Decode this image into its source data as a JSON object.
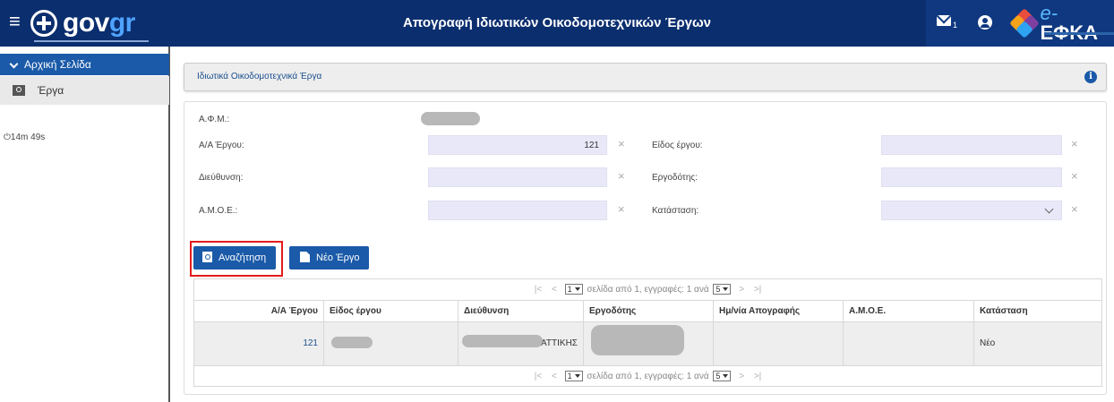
{
  "header": {
    "logo_text_a": "gov",
    "logo_text_b": "gr",
    "title": "Απογραφή Ιδιωτικών Οικοδομοτεχνικών Έργων",
    "mail_count": "1",
    "efka_prefix": "e-",
    "efka_name": "ΕΦΚΑ"
  },
  "sidebar": {
    "home_label": "Αρχική Σελίδα",
    "works_label": "Έργα",
    "timer": "14m 49s"
  },
  "breadcrumb": {
    "title": "Ιδιωτικά Οικοδομοτεχνικά Έργα"
  },
  "form": {
    "afm_label": "Α.Φ.Μ.:",
    "project_no_label": "Α/Α Έργου:",
    "project_no_value": "121",
    "address_label": "Διεύθυνση:",
    "address_value": "",
    "amoe_label": "Α.Μ.Ο.Ε.:",
    "amoe_value": "",
    "project_type_label": "Είδος έργου:",
    "project_type_value": "",
    "employer_label": "Εργοδότης:",
    "employer_value": "",
    "status_label": "Κατάσταση:",
    "status_value": "",
    "clear_glyph": "×"
  },
  "buttons": {
    "search": "Αναζήτηση",
    "new_project": "Νέο Έργο"
  },
  "pager": {
    "first": "|<",
    "prev": "<",
    "page": "1",
    "text": "σελίδα από 1, εγγραφές: 1 ανά",
    "page_size": "5",
    "next": ">",
    "last": ">|"
  },
  "table": {
    "columns": [
      "Α/Α Έργου",
      "Είδος έργου",
      "Διεύθυνση",
      "Εργοδότης",
      "Ημ/νία Απογραφής",
      "Α.Μ.Ο.Ε.",
      "Κατάσταση"
    ],
    "rows": [
      {
        "project_no": "121",
        "project_type": "",
        "address": ", ΑΤΤΙΚΗΣ",
        "employer": "",
        "inventory_date": "",
        "amoe": "",
        "status": "Νέο"
      }
    ]
  },
  "colors": {
    "topbar": "#0b2e6e",
    "accent": "#1a5aa8",
    "field_bg": "#e8e8f8",
    "highlight_frame": "#e31b1b"
  }
}
